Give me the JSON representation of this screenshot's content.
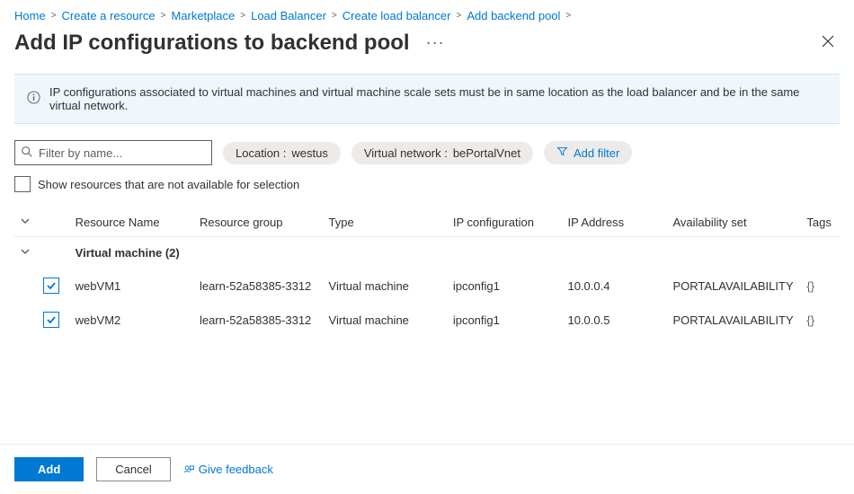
{
  "breadcrumb": [
    {
      "label": "Home"
    },
    {
      "label": "Create a resource"
    },
    {
      "label": "Marketplace"
    },
    {
      "label": "Load Balancer"
    },
    {
      "label": "Create load balancer"
    },
    {
      "label": "Add backend pool"
    }
  ],
  "title": "Add IP configurations to backend pool",
  "info_text": "IP configurations associated to virtual machines and virtual machine scale sets must be in same location as the load balancer and be in the same virtual network.",
  "search_placeholder": "Filter by name...",
  "filters": {
    "location": {
      "label": "Location :",
      "value": "westus"
    },
    "vnet": {
      "label": "Virtual network :",
      "value": "bePortalVnet"
    },
    "add_filter": "Add filter"
  },
  "unavailable_checkbox_label": "Show resources that are not available for selection",
  "columns": {
    "name": "Resource Name",
    "rg": "Resource group",
    "type": "Type",
    "ipconfig": "IP configuration",
    "ip": "IP Address",
    "availset": "Availability set",
    "tags": "Tags"
  },
  "group_label": "Virtual machine (2)",
  "rows": [
    {
      "name": "webVM1",
      "rg": "learn-52a58385-3312",
      "type": "Virtual machine",
      "ipconfig": "ipconfig1",
      "ip": "10.0.0.4",
      "availset": "PORTALAVAILABILITY",
      "tags": "{}"
    },
    {
      "name": "webVM2",
      "rg": "learn-52a58385-3312",
      "type": "Virtual machine",
      "ipconfig": "ipconfig1",
      "ip": "10.0.0.5",
      "availset": "PORTALAVAILABILITY",
      "tags": "{}"
    }
  ],
  "footer": {
    "add": "Add",
    "cancel": "Cancel",
    "feedback": "Give feedback"
  }
}
